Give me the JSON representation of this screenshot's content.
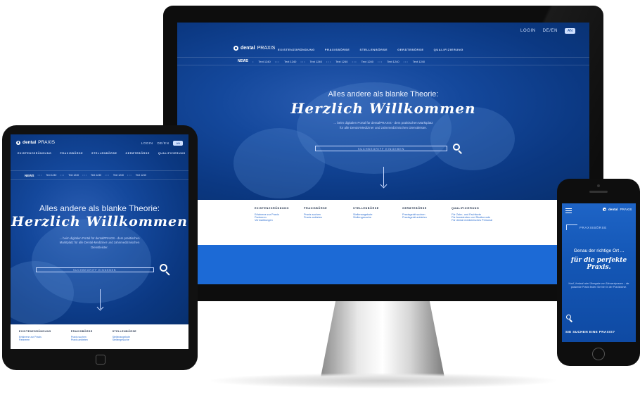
{
  "brand": {
    "name_bold": "dental",
    "name_light": "PRAXIS"
  },
  "header": {
    "login": "LOGIN",
    "toggle_label": "DE/EN",
    "toggle_state": "AN"
  },
  "nav": {
    "items": [
      "EXISTENZGRÜNDUNG",
      "PRAXISBÖRSE",
      "STELLENBÖRSE",
      "GERÄTEBÖRSE",
      "QUALIFIZIERUNG"
    ]
  },
  "news": {
    "label": "NEWS",
    "item": "Text 1240",
    "count": 7
  },
  "hero": {
    "subtitle": "Alles andere als blanke Theorie:",
    "title": "Herzlich Willkommen",
    "desc_desktop_1": "... beim digitalen Portal für dentalPRAXIS - dem praktischen Marktplatz",
    "desc_desktop_2": "für alle Dental-Mediziner und zahnmedizinischen Dienstleister.",
    "desc_tablet_1": "... beim digitalen Portal für dentalPRAXIS - dem praktischen",
    "desc_tablet_2": "Marktplatz für alle Dental-Mediziner und zahnmedizinischen",
    "desc_tablet_3": "Dienstleister.",
    "search_placeholder": "SUCHBEGRIFF EINGEBEN"
  },
  "menu": {
    "columns": [
      {
        "heading": "EXISTENZGRÜNDUNG",
        "links": [
          "Erfahrene zur Praxis",
          "Partneren",
          "Vermarktungen"
        ]
      },
      {
        "heading": "PRAXISBÖRSE",
        "links": [
          "Praxis suchen",
          "Praxis anbieten"
        ]
      },
      {
        "heading": "STELLENBÖRSE",
        "links": [
          "Stellenangebote",
          "Stellengesuche"
        ]
      },
      {
        "heading": "GERÄTEBÖRSE",
        "links": [
          "Praxisgerät suchen",
          "Praxisgerät anbieten"
        ]
      },
      {
        "heading": "QUALIFIZIERUNG",
        "links": [
          "Für Zahn- und Fachärzte",
          "Für Assistenten und Studierende",
          "Für dental medizinisches Personal"
        ]
      }
    ]
  },
  "phone": {
    "section": "PRAXISBÖRSE",
    "heading": "Genau der richtige Ort ...",
    "title_1": "für die perfekte",
    "title_2": "Praxis.",
    "desc": "Kauf, Verkauf oder Übergabe von Zahnarztpraxen – die passende Praxis finden Sie hier in der Praxisbörse.",
    "cta": "SIE SUCHEN EINE PRAXIS?"
  }
}
